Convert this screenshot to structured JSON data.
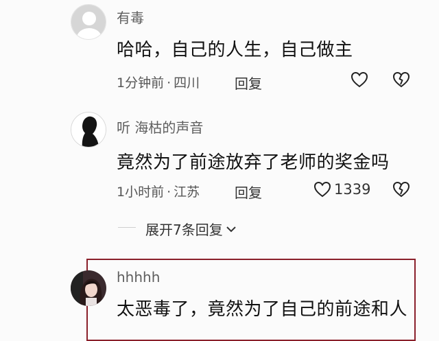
{
  "comments": [
    {
      "username": "有毒",
      "text": "哈哈，自己的人生，自己做主",
      "time": "1分钟前",
      "location": "四川",
      "reply_label": "回复",
      "avatar_icon": "default-avatar-icon"
    },
    {
      "username": "听 海枯的声音",
      "text": "竟然为了前途放弃了老师的奖金吗",
      "time": "1小时前",
      "location": "江苏",
      "reply_label": "回复",
      "likes": "1339",
      "avatar_icon": "silhouette-avatar-icon"
    },
    {
      "username": "hhhhh",
      "text": "太恶毒了，竟然为了自己的前途和人",
      "avatar_icon": "photo-avatar-icon"
    }
  ],
  "dot_separator": "·",
  "expand_replies_label": "展开7条回复",
  "icons": {
    "like": "heart-outline-icon",
    "dislike": "broken-heart-icon",
    "expand": "chevron-down-icon"
  },
  "colors": {
    "highlight_border": "#8a1f2a"
  }
}
